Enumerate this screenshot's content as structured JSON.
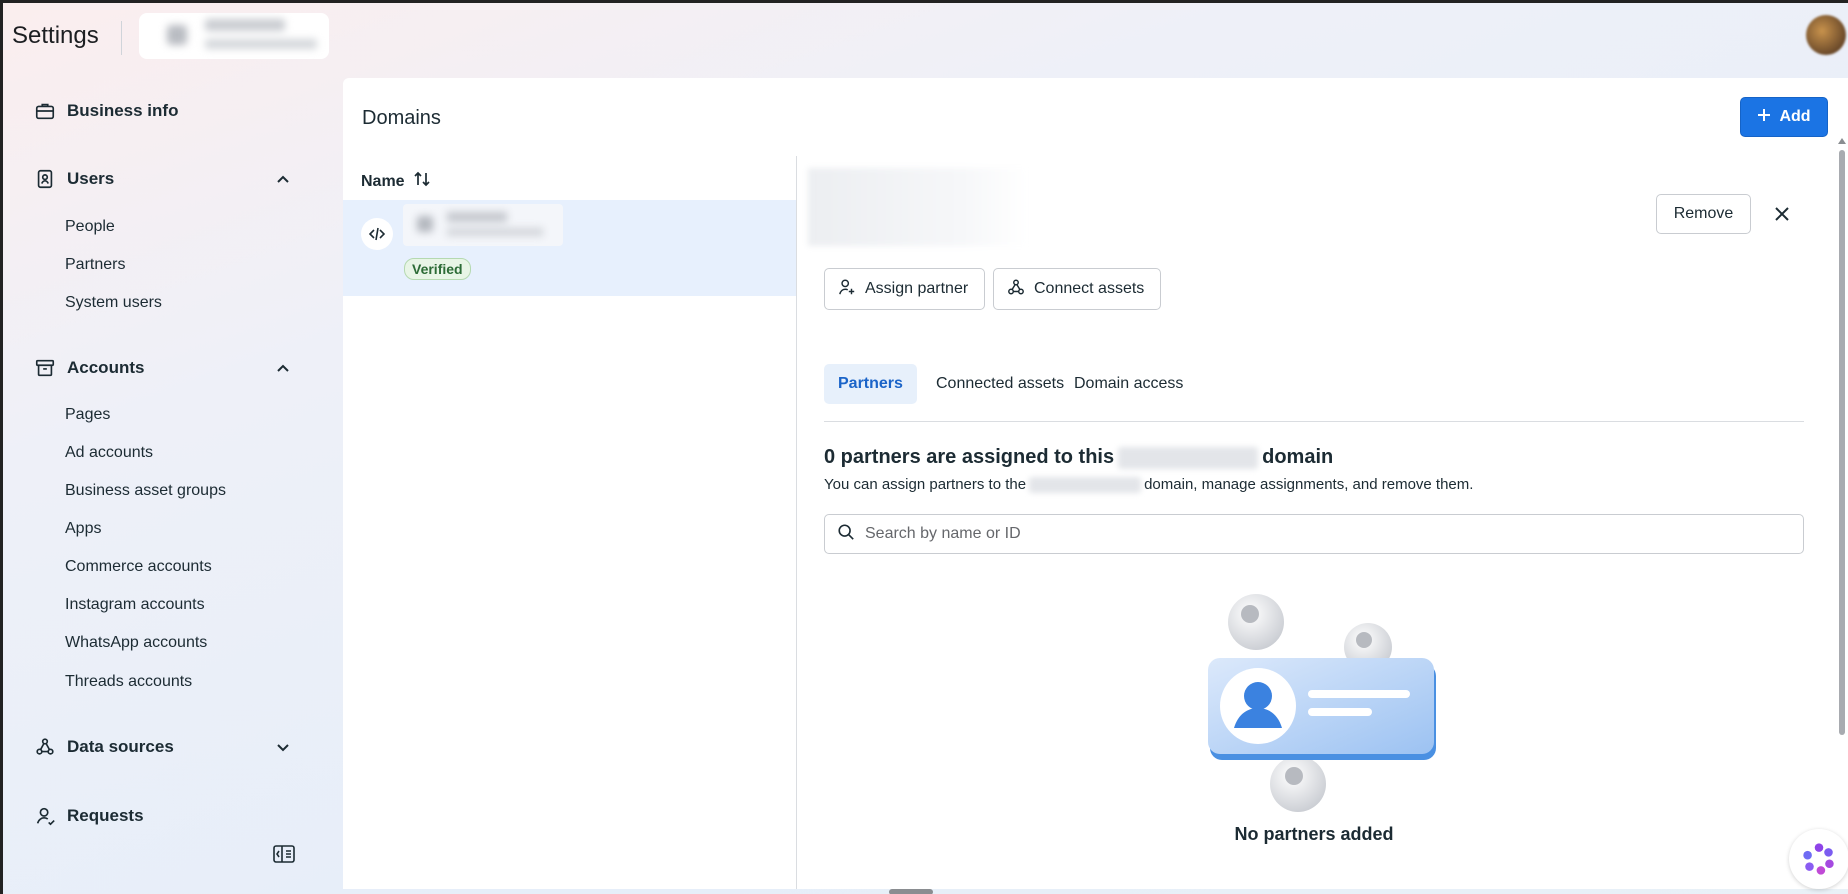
{
  "header": {
    "title": "Settings",
    "business_switcher": "blurred business name"
  },
  "sidebar": {
    "sections": [
      {
        "label": "Business info",
        "icon": "briefcase-icon"
      },
      {
        "label": "Users",
        "icon": "id-badge-icon",
        "expanded": true,
        "items": [
          "People",
          "Partners",
          "System users"
        ]
      },
      {
        "label": "Accounts",
        "icon": "archive-box-icon",
        "expanded": true,
        "items": [
          "Pages",
          "Ad accounts",
          "Business asset groups",
          "Apps",
          "Commerce accounts",
          "Instagram accounts",
          "WhatsApp accounts",
          "Threads accounts"
        ]
      },
      {
        "label": "Data sources",
        "icon": "data-nodes-icon",
        "expanded": false
      },
      {
        "label": "Requests",
        "icon": "person-request-icon"
      }
    ]
  },
  "main": {
    "title": "Domains",
    "add_label": "Add",
    "list": {
      "column_name": "Name",
      "rows": [
        {
          "name": "",
          "status": "Verified"
        }
      ]
    },
    "detail": {
      "remove_label": "Remove",
      "assign_partner_label": "Assign partner",
      "connect_assets_label": "Connect assets",
      "tabs": [
        "Partners",
        "Connected assets",
        "Domain access"
      ],
      "active_tab": "Partners",
      "heading_prefix": "0 partners are assigned to this",
      "heading_suffix": "domain",
      "sub_prefix": "You can assign partners to the",
      "sub_suffix": "domain, manage assignments, and remove them.",
      "search_placeholder": "Search by name or ID",
      "empty_state": "No partners added"
    }
  },
  "colors": {
    "accent": "#1b74e4",
    "active_tab_bg": "#e7f0fb",
    "selected_row_bg": "#e7f0fd",
    "verified_green": "#2c6b36"
  }
}
